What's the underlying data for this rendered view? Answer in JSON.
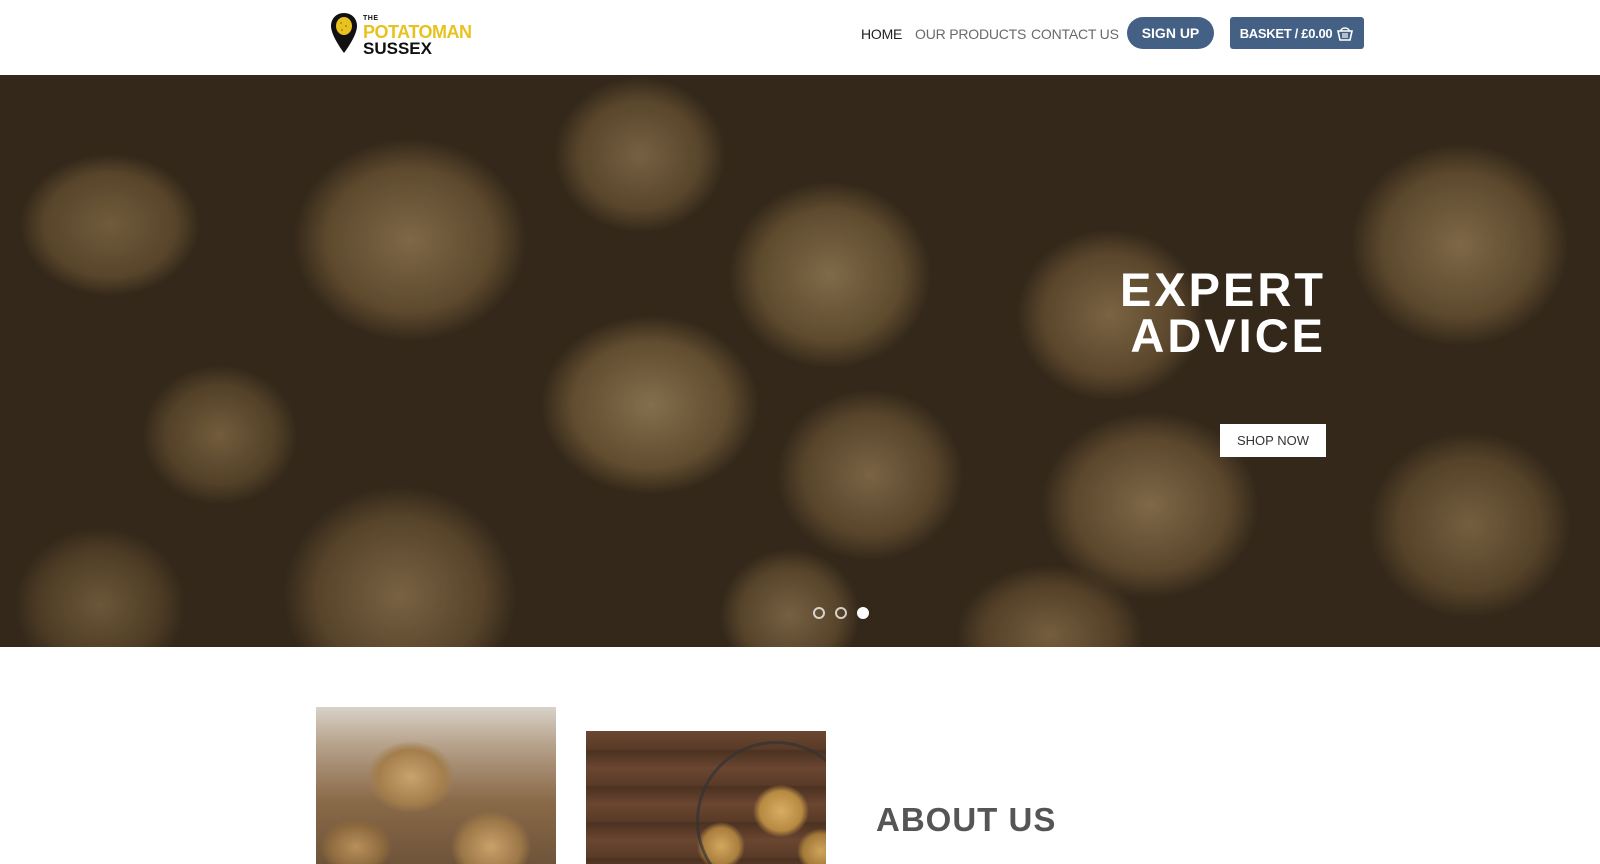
{
  "brand": {
    "the": "THE",
    "name": "POTATOMAN",
    "region": "SUSSEX"
  },
  "nav": {
    "home": "HOME",
    "products": "OUR PRODUCTS",
    "contact": "CONTACT US",
    "signup": "SIGN UP",
    "basket": "BASKET / £0.00"
  },
  "hero": {
    "title_line1": "EXPERT",
    "title_line2": "ADVICE",
    "cta": "SHOP NOW",
    "slides_total": 3,
    "active_slide": 3
  },
  "about": {
    "title": "ABOUT US"
  },
  "colors": {
    "primary": "#446084",
    "brand_yellow": "#e8c21f"
  },
  "icons": [
    "map-pin-icon",
    "basket-icon"
  ]
}
